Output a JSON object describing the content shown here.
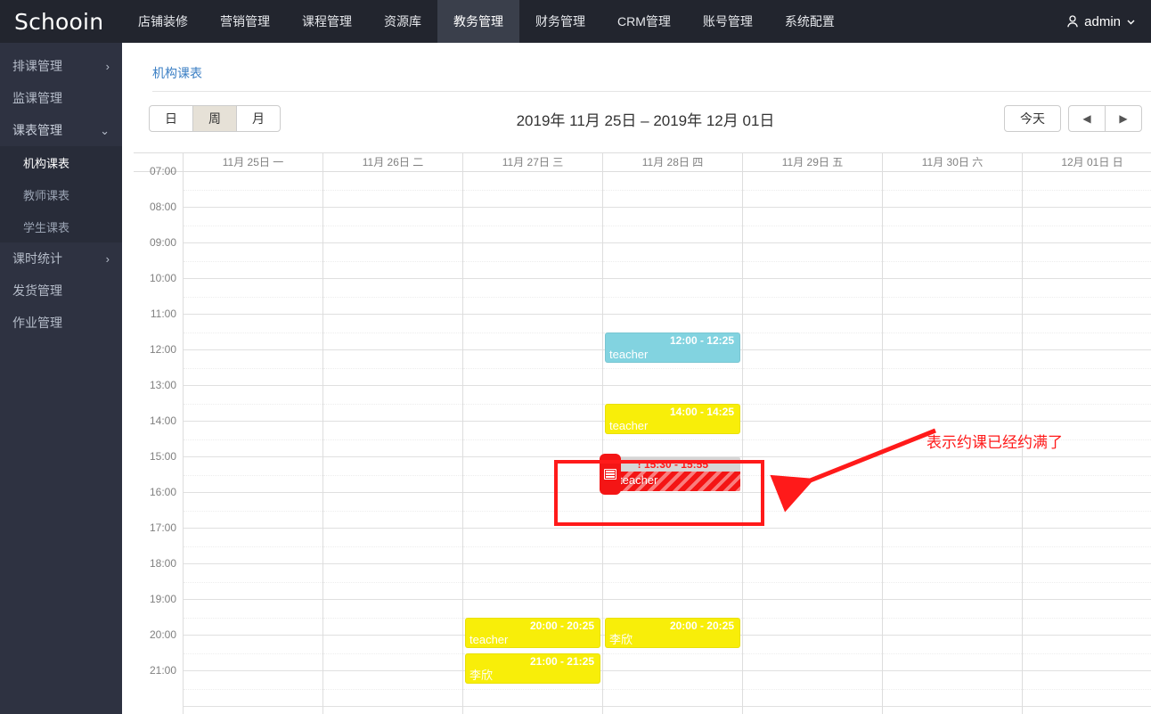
{
  "brand": "Schooin",
  "topnav": {
    "items": [
      {
        "label": "店铺装修",
        "active": false
      },
      {
        "label": "营销管理",
        "active": false
      },
      {
        "label": "课程管理",
        "active": false
      },
      {
        "label": "资源库",
        "active": false
      },
      {
        "label": "教务管理",
        "active": true
      },
      {
        "label": "财务管理",
        "active": false
      },
      {
        "label": "CRM管理",
        "active": false
      },
      {
        "label": "账号管理",
        "active": false
      },
      {
        "label": "系统配置",
        "active": false
      }
    ],
    "user": "admin",
    "user_icon": "user-icon",
    "user_chevron": "chevron-down-icon"
  },
  "sidebar": {
    "items": [
      {
        "label": "排课管理",
        "chevron": "›",
        "expanded": false
      },
      {
        "label": "监课管理",
        "chevron": "",
        "expanded": false
      },
      {
        "label": "课表管理",
        "chevron": "⌄",
        "expanded": true
      },
      {
        "label": "课时统计",
        "chevron": "›",
        "expanded": false
      },
      {
        "label": "发货管理",
        "chevron": "",
        "expanded": false
      },
      {
        "label": "作业管理",
        "chevron": "",
        "expanded": false
      }
    ],
    "submenu": [
      {
        "label": "机构课表",
        "active": true
      },
      {
        "label": "教师课表",
        "active": false
      },
      {
        "label": "学生课表",
        "active": false
      }
    ]
  },
  "breadcrumb": "机构课表",
  "toolbar": {
    "views": [
      {
        "label": "日",
        "active": false
      },
      {
        "label": "周",
        "active": true
      },
      {
        "label": "月",
        "active": false
      }
    ],
    "title": "2019年 11月 25日 – 2019年 12月 01日",
    "today_label": "今天",
    "prev_icon": "◀",
    "next_icon": "▶"
  },
  "calendar": {
    "days": [
      "11月 25日 一",
      "11月 26日 二",
      "11月 27日 三",
      "11月 28日 四",
      "11月 29日 五",
      "11月 30日 六",
      "12月 01日 日"
    ],
    "times": [
      "07:00",
      "08:00",
      "09:00",
      "10:00",
      "11:00",
      "12:00",
      "13:00",
      "14:00",
      "15:00",
      "16:00",
      "17:00",
      "18:00",
      "19:00",
      "20:00",
      "21:00"
    ],
    "events": [
      {
        "day": 3,
        "start_hour": 12.0,
        "duration_hours": 0.6,
        "time": "12:00 - 12:25",
        "title": "teacher",
        "color": "blue"
      },
      {
        "day": 3,
        "start_hour": 14.0,
        "duration_hours": 0.6,
        "time": "14:00 - 14:25",
        "title": "teacher",
        "color": "yellow"
      },
      {
        "day": 2,
        "start_hour": 20.0,
        "duration_hours": 0.6,
        "time": "20:00 - 20:25",
        "title": "teacher",
        "color": "yellow"
      },
      {
        "day": 3,
        "start_hour": 20.0,
        "duration_hours": 0.6,
        "time": "20:00 - 20:25",
        "title": "李欣",
        "color": "yellow"
      },
      {
        "day": 2,
        "start_hour": 21.0,
        "duration_hours": 0.6,
        "time": "21:00 - 21:25",
        "title": "李欣",
        "color": "yellow"
      }
    ],
    "full_event": {
      "day": 3,
      "start_hour": 15.5,
      "time": "! 15:30 - 15:55",
      "title": "teacher",
      "badge_icon": "list-icon",
      "color": "#f41515"
    }
  },
  "annotation": {
    "text": "表示约课已经约满了",
    "color": "#ff1a1a"
  }
}
